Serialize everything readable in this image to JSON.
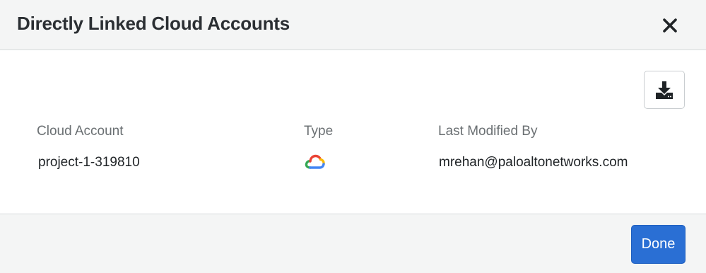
{
  "modal": {
    "title": "Directly Linked Cloud Accounts"
  },
  "icons": {
    "close": "close-icon",
    "download": "download-icon",
    "gcp": "google-cloud-icon"
  },
  "table": {
    "columns": [
      "Cloud Account",
      "Type",
      "Last Modified By"
    ],
    "rows": [
      {
        "cloud_account": "project-1-319810",
        "type": "Google Cloud",
        "last_modified_by": "mrehan@paloaltonetworks.com"
      }
    ]
  },
  "footer": {
    "done_label": "Done"
  },
  "colors": {
    "primary": "#2a6fd4",
    "gcp_blue": "#4285F4",
    "gcp_red": "#EA4335",
    "gcp_yellow": "#FBBC05",
    "gcp_green": "#34A853"
  }
}
